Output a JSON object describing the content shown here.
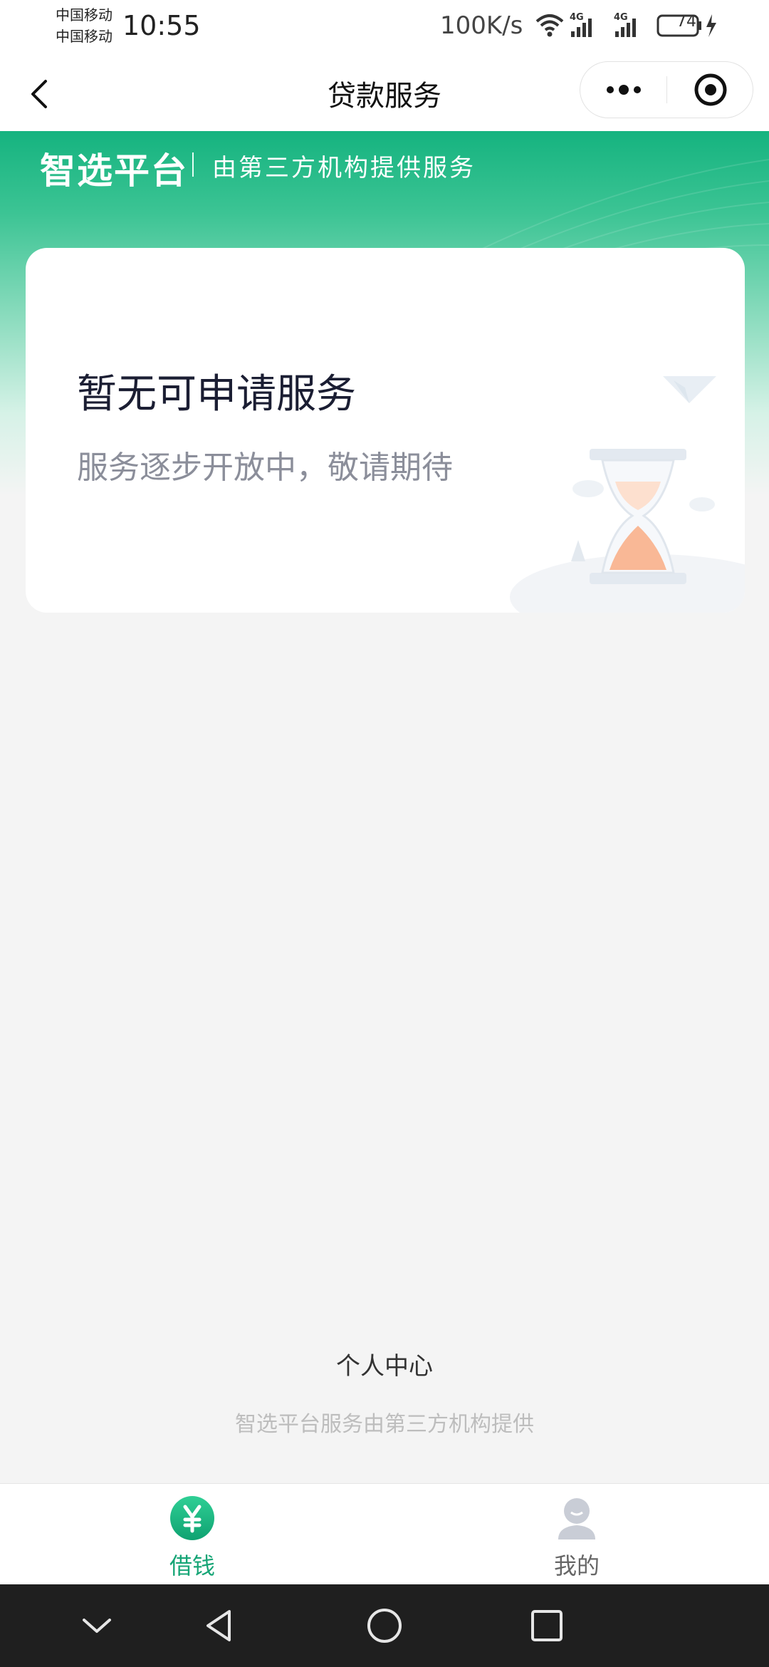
{
  "status_bar": {
    "carrier_1": "中国移动",
    "carrier_2": "中国移动",
    "time": "10:55",
    "net_speed": "100K/s",
    "signal_1_label": "4G",
    "signal_2_label": "4G",
    "battery": "74"
  },
  "nav": {
    "title": "贷款服务",
    "back_icon": "chevron-left-icon",
    "more_icon": "more-dots-icon",
    "close_icon": "target-icon"
  },
  "header": {
    "brand": "智选平台",
    "subtitle": "由第三方机构提供服务",
    "color": "#15b37f"
  },
  "card": {
    "title": "暂无可申请服务",
    "subtitle": "服务逐步开放中，敬请期待",
    "illustration": "hourglass-icon"
  },
  "footer": {
    "personal_center": "个人中心",
    "provider_note": "智选平台服务由第三方机构提供"
  },
  "tabs": [
    {
      "label": "借钱",
      "icon": "yuan-icon",
      "active": true
    },
    {
      "label": "我的",
      "icon": "user-icon",
      "active": false
    }
  ],
  "colors": {
    "accent": "#16a576",
    "background": "#f4f4f4"
  }
}
